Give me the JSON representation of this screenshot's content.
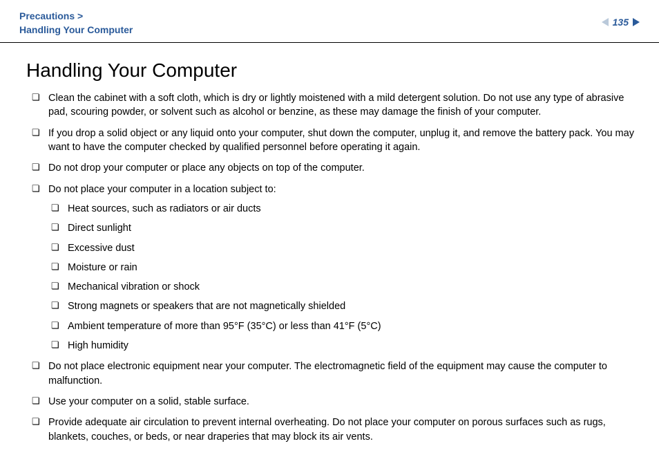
{
  "header": {
    "breadcrumb_top": "Precautions >",
    "breadcrumb_bottom": "Handling Your Computer",
    "page_number": "135"
  },
  "title": "Handling Your Computer",
  "bullets": [
    {
      "text": "Clean the cabinet with a soft cloth, which is dry or lightly moistened with a mild detergent solution. Do not use any type of abrasive pad, scouring powder, or solvent such as alcohol or benzine, as these may damage the finish of your computer."
    },
    {
      "text": "If you drop a solid object or any liquid onto your computer, shut down the computer, unplug it, and remove the battery pack. You may want to have the computer checked by qualified personnel before operating it again."
    },
    {
      "text": "Do not drop your computer or place any objects on top of the computer."
    },
    {
      "text": "Do not place your computer in a location subject to:",
      "sub": [
        "Heat sources, such as radiators or air ducts",
        "Direct sunlight",
        "Excessive dust",
        "Moisture or rain",
        "Mechanical vibration or shock",
        "Strong magnets or speakers that are not magnetically shielded",
        "Ambient temperature of more than 95°F (35°C) or less than 41°F (5°C)",
        "High humidity"
      ]
    },
    {
      "text": "Do not place electronic equipment near your computer. The electromagnetic field of the equipment may cause the computer to malfunction."
    },
    {
      "text": "Use your computer on a solid, stable surface."
    },
    {
      "text": "Provide adequate air circulation to prevent internal overheating. Do not place your computer on porous surfaces such as rugs, blankets, couches, or beds, or near draperies that may block its air vents."
    }
  ]
}
